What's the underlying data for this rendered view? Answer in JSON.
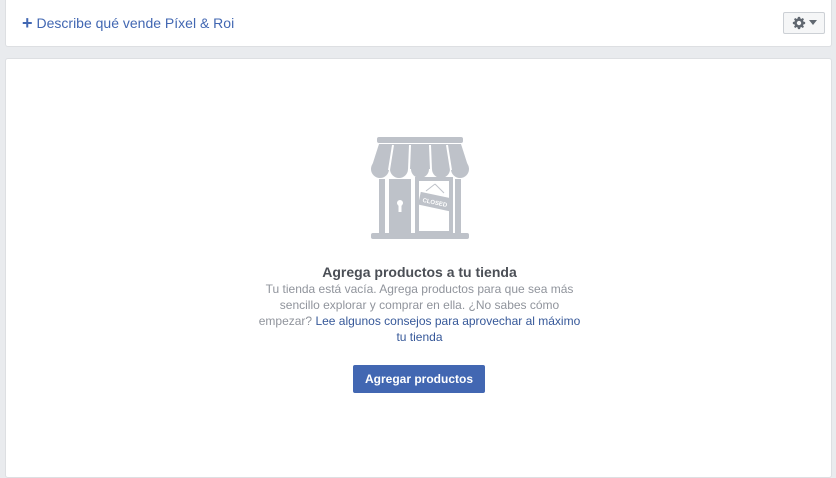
{
  "header": {
    "describe_link": "Describe qué vende Píxel & Roi",
    "plus_icon": "plus-icon",
    "settings_icon": "gear-icon",
    "dropdown_icon": "caret-down-icon"
  },
  "empty_state": {
    "illustration": "closed-store-icon",
    "sign_text": "CLOSED",
    "title": "Agrega productos a tu tienda",
    "description": "Tu tienda está vacía. Agrega productos para que sea más sencillo explorar y comprar en ella. ¿No sabes cómo empezar?",
    "tips_link": "Lee algunos consejos para aprovechar al máximo tu tienda",
    "add_button": "Agregar productos"
  },
  "colors": {
    "link": "#4267b2",
    "primary_button": "#4267b2",
    "page_background": "#e9ebee",
    "illustration": "#bec2c9"
  }
}
